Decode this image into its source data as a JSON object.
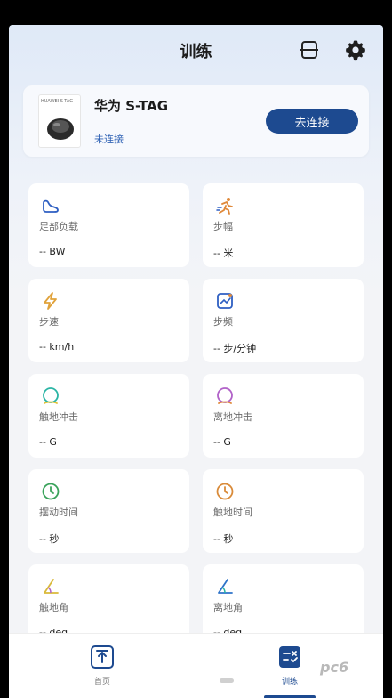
{
  "header": {
    "title": "训练"
  },
  "device": {
    "name": "华为 S-TAG",
    "status": "未连接",
    "connect_label": "去连接",
    "image_brand": "HUAWEI S-TAG"
  },
  "metrics": [
    {
      "label": "足部负载",
      "value": "-- BW",
      "icon": "foot-icon",
      "color": "#2e5fc2"
    },
    {
      "label": "步幅",
      "value": "-- 米",
      "icon": "stride-icon",
      "color": "#e0893a"
    },
    {
      "label": "步速",
      "value": "-- km/h",
      "icon": "lightning-icon",
      "color": "#e0a23a"
    },
    {
      "label": "步频",
      "value": "-- 步/分钟",
      "icon": "trend-chart-icon",
      "color": "#2e5fc2"
    },
    {
      "label": "触地冲击",
      "value": "-- G",
      "icon": "impact-icon",
      "color": "#2bb5a5"
    },
    {
      "label": "离地冲击",
      "value": "-- G",
      "icon": "impact-icon",
      "color": "#b162c8"
    },
    {
      "label": "摆动时间",
      "value": "-- 秒",
      "icon": "clock-icon",
      "color": "#3aa35b"
    },
    {
      "label": "触地时间",
      "value": "-- 秒",
      "icon": "clock-icon",
      "color": "#d98b3a"
    },
    {
      "label": "触地角",
      "value": "-- deg",
      "icon": "angle-icon",
      "color": "#d9b93a"
    },
    {
      "label": "离地角",
      "value": "-- deg",
      "icon": "angle-icon",
      "color": "#2e73c9"
    }
  ],
  "tabs": {
    "home_label": "首页",
    "train_label": "训练"
  },
  "watermark": "pc6"
}
